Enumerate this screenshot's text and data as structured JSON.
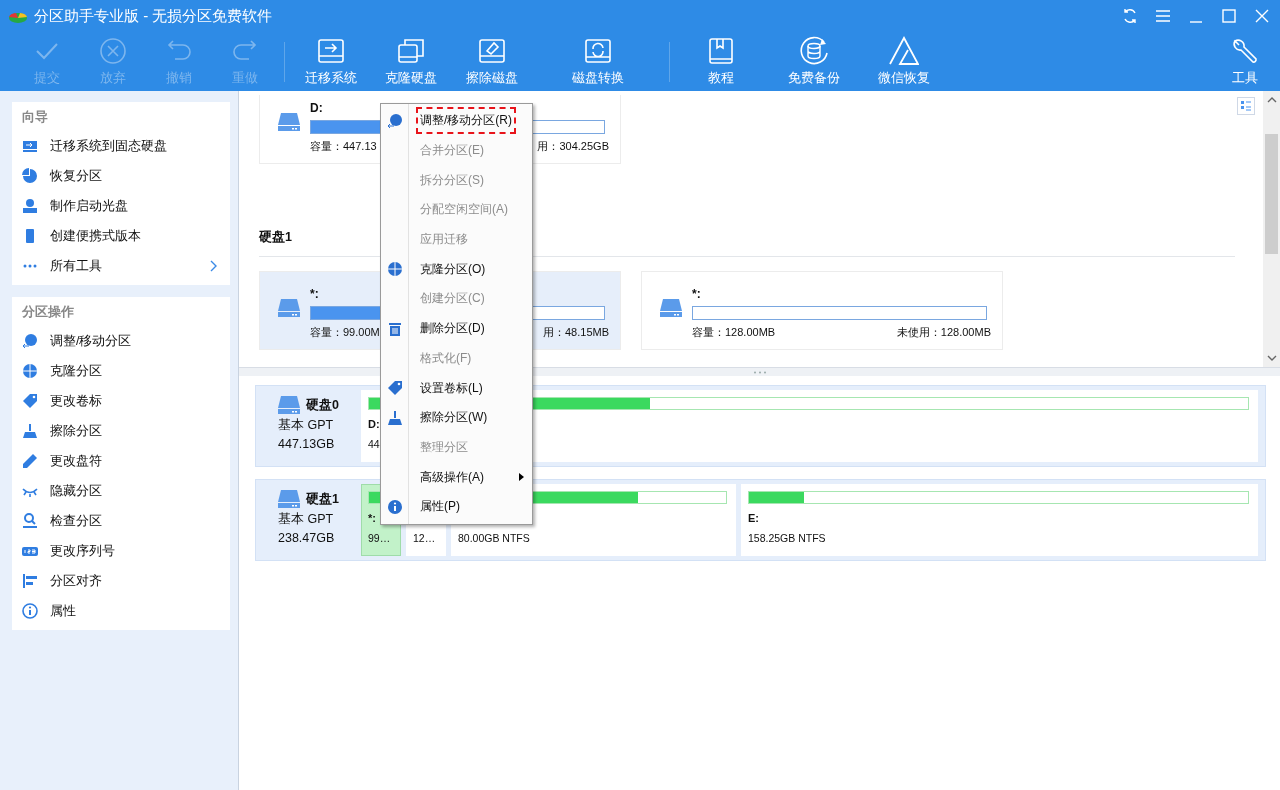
{
  "window": {
    "title": "分区助手专业版 - 无损分区免费软件"
  },
  "toolbar": [
    {
      "label": "提交",
      "disabled": true
    },
    {
      "label": "放弃",
      "disabled": true
    },
    {
      "label": "撤销",
      "disabled": true
    },
    {
      "label": "重做",
      "disabled": true
    },
    {
      "label": "迁移系统",
      "disabled": false
    },
    {
      "label": "克隆硬盘",
      "disabled": false
    },
    {
      "label": "擦除磁盘",
      "disabled": false
    },
    {
      "label": "磁盘转换",
      "disabled": false
    },
    {
      "label": "教程",
      "disabled": false
    },
    {
      "label": "免费备份",
      "disabled": false
    },
    {
      "label": "微信恢复",
      "disabled": false
    },
    {
      "label": "工具",
      "disabled": false
    }
  ],
  "sidebar": {
    "sections": [
      {
        "title": "向导",
        "items": [
          {
            "label": "迁移系统到固态硬盘",
            "submenu": false
          },
          {
            "label": "恢复分区",
            "submenu": false
          },
          {
            "label": "制作启动光盘",
            "submenu": false
          },
          {
            "label": "创建便携式版本",
            "submenu": false
          },
          {
            "label": "所有工具",
            "submenu": true
          }
        ]
      },
      {
        "title": "分区操作",
        "items": [
          {
            "label": "调整/移动分区",
            "submenu": false
          },
          {
            "label": "克隆分区",
            "submenu": false
          },
          {
            "label": "更改卷标",
            "submenu": false
          },
          {
            "label": "擦除分区",
            "submenu": false
          },
          {
            "label": "更改盘符",
            "submenu": false
          },
          {
            "label": "隐藏分区",
            "submenu": false
          },
          {
            "label": "检查分区",
            "submenu": false
          },
          {
            "label": "更改序列号",
            "submenu": false
          },
          {
            "label": "分区对齐",
            "submenu": false
          },
          {
            "label": "属性",
            "submenu": false
          }
        ]
      }
    ]
  },
  "partition_view": {
    "upper_cards": [
      {
        "label": "D:",
        "level": 0.32,
        "capacity": "容量：447.13",
        "unused": "用：304.25GB",
        "selected": false
      }
    ],
    "disk_heading": "硬盘1",
    "cards": [
      {
        "label": "*:",
        "level": 0.51,
        "capacity": "容量：99.00M",
        "unused": "用：48.15MB",
        "selected": true
      },
      {
        "label": "*:",
        "level": 0,
        "capacity": "容量：128.00MB",
        "unused": "未使用：128.00MB",
        "selected": false
      }
    ]
  },
  "disk_map": [
    {
      "name": "硬盘0",
      "type": "基本 GPT",
      "size": "447.13GB",
      "partitions": [
        {
          "label": "D:",
          "info": "44",
          "level": 0.32,
          "selected": false
        }
      ]
    },
    {
      "name": "硬盘1",
      "type": "基本 GPT",
      "size": "238.47GB",
      "partitions": [
        {
          "label": "*:",
          "info": "99…",
          "level": 0.9,
          "selected": true
        },
        {
          "info": "12…",
          "selected": false
        },
        {
          "info": "80.00GB NTFS",
          "level": 0.67,
          "selected": false
        },
        {
          "label": "E:",
          "info": "158.25GB NTFS",
          "level": 0.11,
          "selected": false
        }
      ]
    }
  ],
  "context_menu": {
    "items": [
      {
        "label": "调整/移动分区(R)",
        "disabled": false,
        "selected": true,
        "submenu": false
      },
      {
        "label": "合并分区(E)",
        "disabled": true,
        "selected": false,
        "submenu": false
      },
      {
        "label": "拆分分区(S)",
        "disabled": true,
        "selected": false,
        "submenu": false
      },
      {
        "label": "分配空闲空间(A)",
        "disabled": true,
        "selected": false,
        "submenu": false
      },
      {
        "label": "应用迁移",
        "disabled": true,
        "selected": false,
        "submenu": false
      },
      {
        "label": "克隆分区(O)",
        "disabled": false,
        "selected": false,
        "submenu": false
      },
      {
        "label": "创建分区(C)",
        "disabled": true,
        "selected": false,
        "submenu": false
      },
      {
        "label": "删除分区(D)",
        "disabled": false,
        "selected": false,
        "submenu": false
      },
      {
        "label": "格式化(F)",
        "disabled": true,
        "selected": false,
        "submenu": false
      },
      {
        "label": "设置卷标(L)",
        "disabled": false,
        "selected": false,
        "submenu": false
      },
      {
        "label": "擦除分区(W)",
        "disabled": false,
        "selected": false,
        "submenu": false
      },
      {
        "label": "整理分区",
        "disabled": true,
        "selected": false,
        "submenu": false
      },
      {
        "label": "高级操作(A)",
        "disabled": false,
        "selected": false,
        "submenu": true
      },
      {
        "label": "属性(P)",
        "disabled": false,
        "selected": false,
        "submenu": false
      }
    ]
  }
}
